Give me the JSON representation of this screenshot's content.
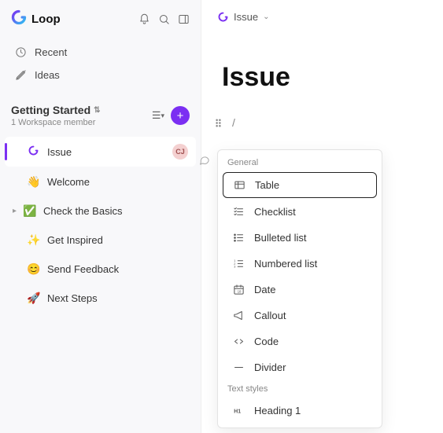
{
  "app": {
    "name": "Loop"
  },
  "nav": {
    "recent": "Recent",
    "ideas": "Ideas"
  },
  "workspace": {
    "title": "Getting Started",
    "subtitle": "1 Workspace member"
  },
  "pages": [
    {
      "icon": "loop",
      "label": "Issue",
      "selected": true,
      "avatar": "CJ"
    },
    {
      "icon": "👋",
      "label": "Welcome"
    },
    {
      "icon": "✅",
      "label": "Check the Basics",
      "expandable": true
    },
    {
      "icon": "✨",
      "label": "Get Inspired"
    },
    {
      "icon": "😊",
      "label": "Send Feedback"
    },
    {
      "icon": "🚀",
      "label": "Next Steps"
    }
  ],
  "breadcrumb": {
    "label": "Issue"
  },
  "pageTitle": "Issue",
  "slashChar": "/",
  "menu": {
    "sections": [
      {
        "title": "General",
        "items": [
          {
            "icon": "table",
            "label": "Table",
            "selected": true
          },
          {
            "icon": "checklist",
            "label": "Checklist"
          },
          {
            "icon": "bullets",
            "label": "Bulleted list"
          },
          {
            "icon": "numbered",
            "label": "Numbered list"
          },
          {
            "icon": "date",
            "label": "Date"
          },
          {
            "icon": "callout",
            "label": "Callout"
          },
          {
            "icon": "code",
            "label": "Code"
          },
          {
            "icon": "divider",
            "label": "Divider"
          }
        ]
      },
      {
        "title": "Text styles",
        "items": [
          {
            "icon": "h1",
            "label": "Heading 1"
          }
        ]
      }
    ]
  }
}
